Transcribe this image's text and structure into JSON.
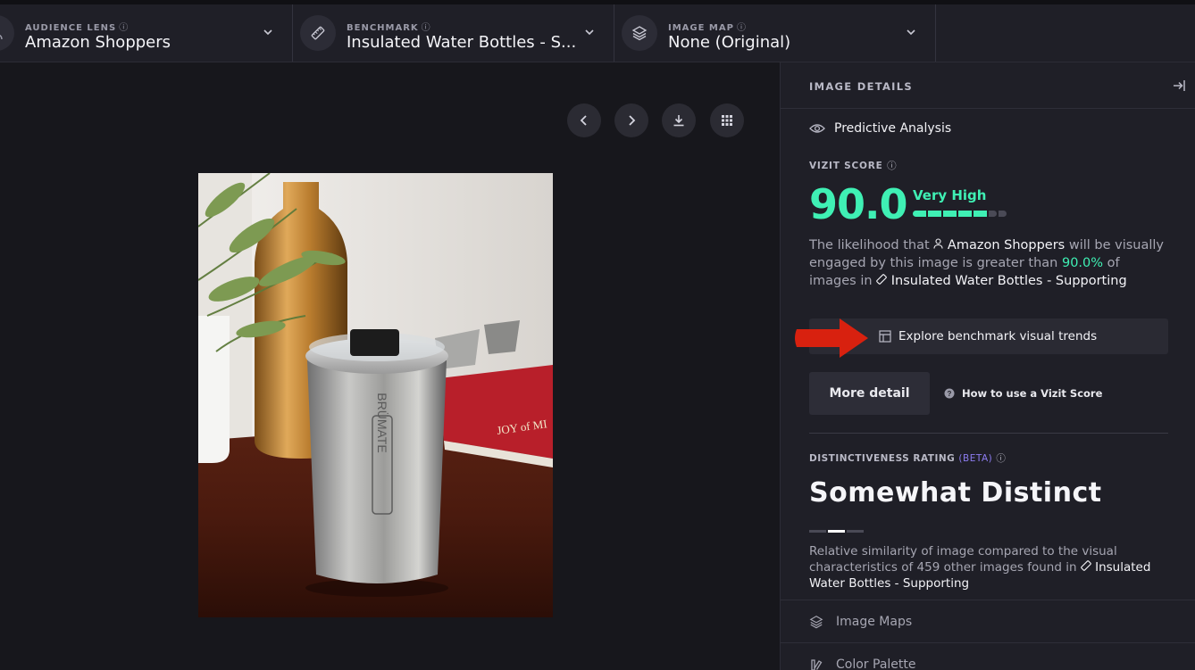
{
  "topbar": {
    "audience": {
      "label": "AUDIENCE LENS",
      "value": "Amazon Shoppers"
    },
    "benchmark": {
      "label": "BENCHMARK",
      "value": "Insulated Water Bottles - S..."
    },
    "image_map": {
      "label": "IMAGE MAP",
      "value": "None (Original)"
    },
    "info_glyph": "ⓘ"
  },
  "panel": {
    "title": "IMAGE DETAILS",
    "predictive": "Predictive Analysis",
    "score_label": "VIZIT SCORE",
    "score": "90.0",
    "score_rating": "Very High",
    "score_level": 0.9,
    "desc": {
      "p1": "The likelihood that",
      "audience": "Amazon Shoppers",
      "p2": "will be visually engaged by this image is greater than",
      "pct": "90.0%",
      "p3": "of images in",
      "benchmark": "Insulated Water Bottles - Supporting"
    },
    "explore": "Explore benchmark visual trends",
    "more_detail": "More detail",
    "how_to": "How to use a Vizit Score",
    "dist_label": "DISTINCTIVENESS RATING",
    "beta": "(BETA)",
    "distinct": "Somewhat Distinct",
    "dist_desc": {
      "p1": "Relative similarity of image compared to the visual characteristics of 459 other images found in",
      "benchmark": "Insulated Water Bottles - Supporting"
    },
    "rows": [
      "Image Maps",
      "Color Palette"
    ]
  },
  "colors": {
    "accent": "#3ff0b4",
    "arrow": "#d8210f",
    "beta": "#8c7cf0"
  }
}
